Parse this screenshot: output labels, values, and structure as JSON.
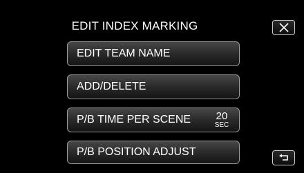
{
  "header": {
    "title": "EDIT INDEX MARKING",
    "close_icon": "close-icon"
  },
  "menu": {
    "items": [
      {
        "label": "EDIT TEAM NAME"
      },
      {
        "label": "ADD/DELETE"
      },
      {
        "label": "P/B TIME PER SCENE",
        "value": "20",
        "unit": "SEC"
      },
      {
        "label": "P/B POSITION ADJUST"
      }
    ]
  },
  "footer": {
    "back_icon": "return-icon"
  },
  "colors": {
    "background": "#000000",
    "button_border": "#9a9a9a",
    "text": "#ffffff"
  }
}
